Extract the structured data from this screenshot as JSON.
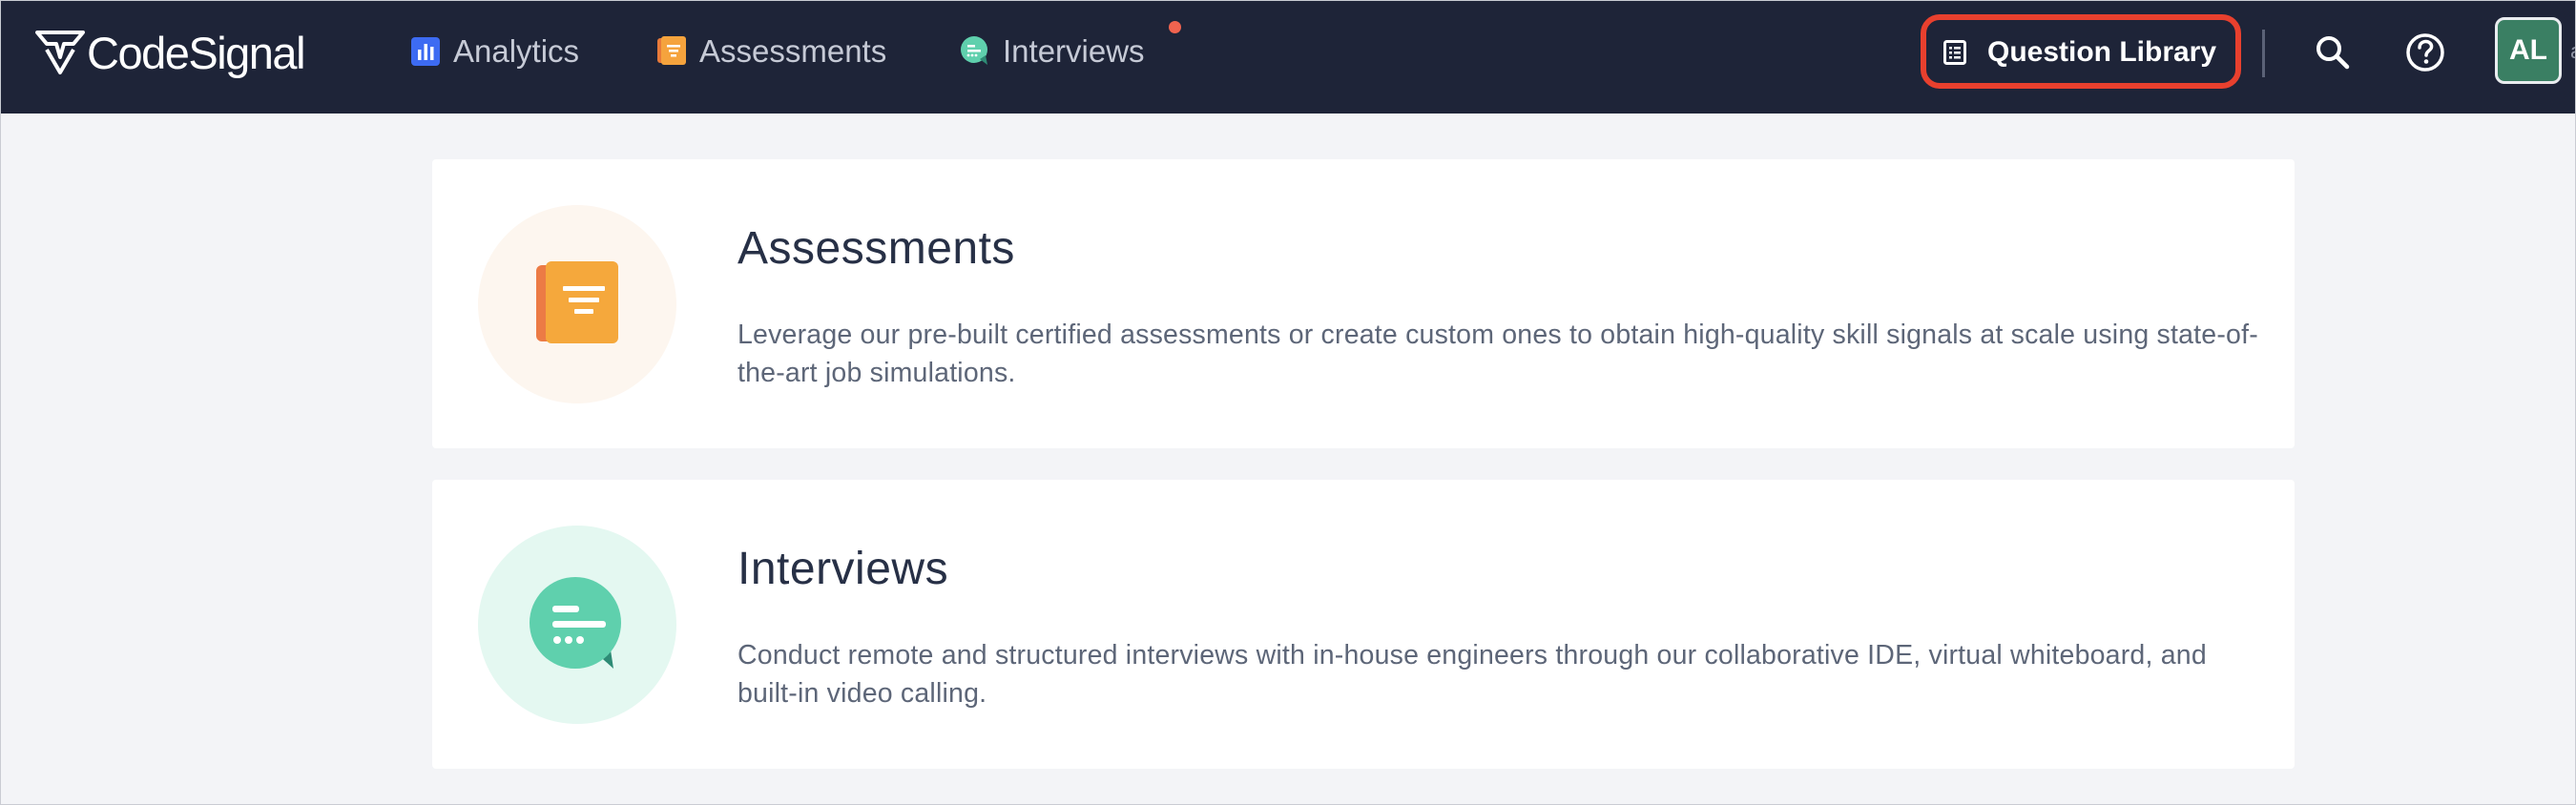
{
  "brand": {
    "name": "CodeSignal"
  },
  "nav": {
    "items": [
      {
        "label": "Analytics",
        "icon": "analytics-icon",
        "color": "#3d6bf2"
      },
      {
        "label": "Assessments",
        "icon": "assessments-icon",
        "color": "#f5a33d"
      },
      {
        "label": "Interviews",
        "icon": "interviews-icon",
        "color": "#5fd0ad",
        "has_notification": true
      }
    ]
  },
  "header": {
    "question_library_label": "Question Library",
    "search_icon": "search-icon",
    "help_icon": "help-icon",
    "avatar_initials": "AL",
    "avatar_color": "#3a7f63",
    "overflow_text": "a"
  },
  "cards": [
    {
      "title": "Assessments",
      "description": "Leverage our pre-built certified assessments or create custom ones to obtain high-quality skill signals at scale using state-of-the-art job simulations.",
      "icon": "assessment-document-icon"
    },
    {
      "title": "Interviews",
      "description": "Conduct remote and structured interviews with in-house engineers through our collaborative IDE, virtual whiteboard, and built-in video calling.",
      "icon": "interview-chat-icon"
    }
  ],
  "colors": {
    "topbar": "#1e2438",
    "page_background": "#f3f4f7",
    "highlight": "#e8402e",
    "notification": "#f0634f"
  }
}
